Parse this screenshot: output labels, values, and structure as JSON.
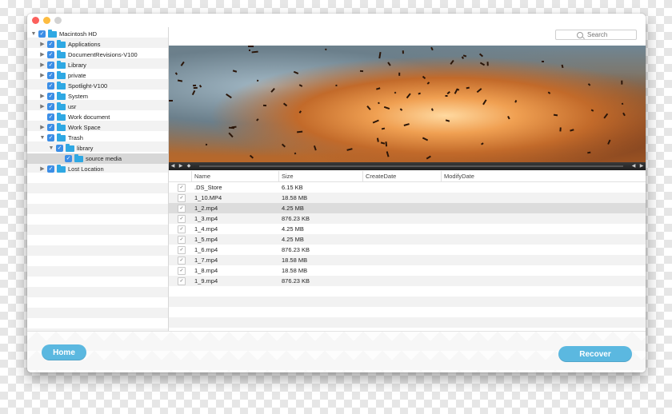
{
  "search": {
    "placeholder": "Search"
  },
  "tree": [
    {
      "label": "Macintosh HD",
      "arrow": "▼",
      "indent": 0,
      "checked": true
    },
    {
      "label": "Applications",
      "arrow": "▶",
      "indent": 1,
      "checked": true
    },
    {
      "label": "DocumentRevisions-V100",
      "arrow": "▶",
      "indent": 1,
      "checked": true
    },
    {
      "label": "Library",
      "arrow": "▶",
      "indent": 1,
      "checked": true
    },
    {
      "label": "private",
      "arrow": "▶",
      "indent": 1,
      "checked": true
    },
    {
      "label": "Spotlight-V100",
      "arrow": "",
      "indent": 1,
      "checked": true
    },
    {
      "label": "System",
      "arrow": "▶",
      "indent": 1,
      "checked": true
    },
    {
      "label": "usr",
      "arrow": "▶",
      "indent": 1,
      "checked": true
    },
    {
      "label": "Work document",
      "arrow": "",
      "indent": 1,
      "checked": true
    },
    {
      "label": "Work Space",
      "arrow": "▶",
      "indent": 1,
      "checked": true
    },
    {
      "label": "Trash",
      "arrow": "▼",
      "indent": 1,
      "checked": true
    },
    {
      "label": "library",
      "arrow": "▼",
      "indent": 2,
      "checked": true
    },
    {
      "label": "source media",
      "arrow": "",
      "indent": 3,
      "checked": true,
      "selected": true
    },
    {
      "label": "Lost Location",
      "arrow": "▶",
      "indent": 1,
      "checked": true
    }
  ],
  "columns": [
    "Name",
    "Size",
    "CreateDate",
    "ModifyDate"
  ],
  "files": [
    {
      "name": ".DS_Store",
      "size": "6.15 KB"
    },
    {
      "name": "1_10.MP4",
      "size": "18.58 MB"
    },
    {
      "name": "1_2.mp4",
      "size": "4.25 MB",
      "selected": true
    },
    {
      "name": "1_3.mp4",
      "size": "876.23 KB"
    },
    {
      "name": "1_4.mp4",
      "size": "4.25 MB"
    },
    {
      "name": "1_5.mp4",
      "size": "4.25 MB"
    },
    {
      "name": "1_6.mp4",
      "size": "876.23 KB"
    },
    {
      "name": "1_7.mp4",
      "size": "18.58 MB"
    },
    {
      "name": "1_8.mp4",
      "size": "18.58 MB"
    },
    {
      "name": "1_9.mp4",
      "size": "876.23 KB"
    }
  ],
  "buttons": {
    "home": "Home",
    "recover": "Recover"
  },
  "colors": {
    "accent": "#5bb8e0",
    "checkbox": "#3c8ee6",
    "folder": "#2fa8e3"
  },
  "icons": {
    "check": "✓",
    "play": "▶",
    "volume": "◀"
  }
}
